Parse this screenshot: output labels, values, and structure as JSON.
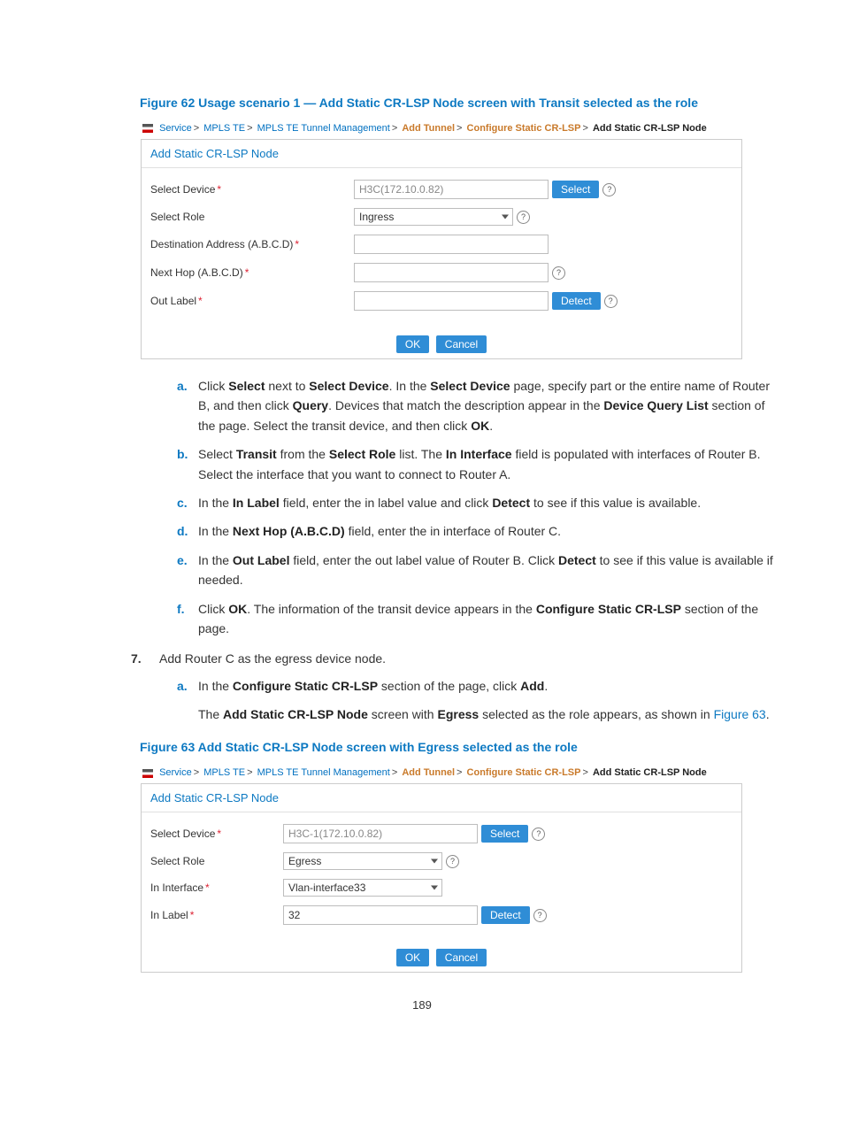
{
  "figure62": {
    "caption": "Figure 62 Usage scenario 1 — Add Static CR-LSP Node screen with Transit selected as the role",
    "breadcrumb": {
      "service": "Service",
      "mpls_te": "MPLS TE",
      "tunnel_mgmt": "MPLS TE Tunnel Management",
      "add_tunnel": "Add Tunnel",
      "config_static": "Configure Static CR-LSP",
      "add_node": "Add Static CR-LSP Node"
    },
    "panel_title": "Add Static CR-LSP Node",
    "labels": {
      "select_device": "Select Device",
      "select_role": "Select Role",
      "dest_addr": "Destination Address (A.B.C.D)",
      "next_hop": "Next Hop (A.B.C.D)",
      "out_label": "Out Label"
    },
    "values": {
      "device": "H3C(172.10.0.82)",
      "role": "Ingress"
    },
    "buttons": {
      "select": "Select",
      "detect": "Detect",
      "ok": "OK",
      "cancel": "Cancel"
    }
  },
  "steps_a_to_f": {
    "a_pre": "Click ",
    "a_b1": "Select",
    "a_mid1": " next to ",
    "a_b2": "Select Device",
    "a_mid2": ". In the ",
    "a_b3": "Select Device",
    "a_mid3": " page, specify part or the entire name of Router B, and then click ",
    "a_b4": "Query",
    "a_mid4": ". Devices that match the description appear in the ",
    "a_b5": "Device Query List",
    "a_mid5": " section of the page. Select the transit device, and then click ",
    "a_b6": "OK",
    "a_post": ".",
    "b_pre": "Select ",
    "b_b1": "Transit",
    "b_mid1": " from the ",
    "b_b2": "Select Role",
    "b_mid2": " list. The ",
    "b_b3": "In Interface",
    "b_mid3": " field is populated with interfaces of Router B. Select the interface that you want to connect to Router A.",
    "c_pre": "In the ",
    "c_b1": "In Label",
    "c_mid1": " field, enter the in label value and click ",
    "c_b2": "Detect",
    "c_post": " to see if this value is available.",
    "d_pre": "In the ",
    "d_b1": "Next Hop (A.B.C.D)",
    "d_post": " field, enter the in interface of Router C.",
    "e_pre": "In the ",
    "e_b1": "Out Label",
    "e_mid1": " field, enter the out label value of Router B. Click ",
    "e_b2": "Detect",
    "e_post": " to see if this value is available if needed.",
    "f_pre": "Click ",
    "f_b1": "OK",
    "f_mid1": ". The information of the transit device appears in the ",
    "f_b2": "Configure Static CR-LSP",
    "f_post": " section of the page."
  },
  "step7": {
    "text": "Add Router C as the egress device node.",
    "a_pre": "In the ",
    "a_b1": "Configure Static CR-LSP",
    "a_mid1": " section of the page, click ",
    "a_b2": "Add",
    "a_post": ".",
    "para_pre": "The ",
    "para_b1": "Add Static CR-LSP Node",
    "para_mid1": " screen with ",
    "para_b2": "Egress",
    "para_mid2": " selected as the role appears, as shown in ",
    "para_link": "Figure 63",
    "para_post": "."
  },
  "figure63": {
    "caption": "Figure 63 Add Static CR-LSP Node screen with Egress selected as the role",
    "breadcrumb": {
      "service": "Service",
      "mpls_te": "MPLS TE",
      "tunnel_mgmt": "MPLS TE Tunnel Management",
      "add_tunnel": "Add Tunnel",
      "config_static": "Configure Static CR-LSP",
      "add_node": "Add Static CR-LSP Node"
    },
    "panel_title": "Add Static CR-LSP Node",
    "labels": {
      "select_device": "Select Device",
      "select_role": "Select Role",
      "in_interface": "In Interface",
      "in_label": "In Label"
    },
    "values": {
      "device": "H3C-1(172.10.0.82)",
      "role": "Egress",
      "interface": "Vlan-interface33",
      "in_label": "32"
    },
    "buttons": {
      "select": "Select",
      "detect": "Detect",
      "ok": "OK",
      "cancel": "Cancel"
    }
  },
  "page_number": "189",
  "help_glyph": "?"
}
